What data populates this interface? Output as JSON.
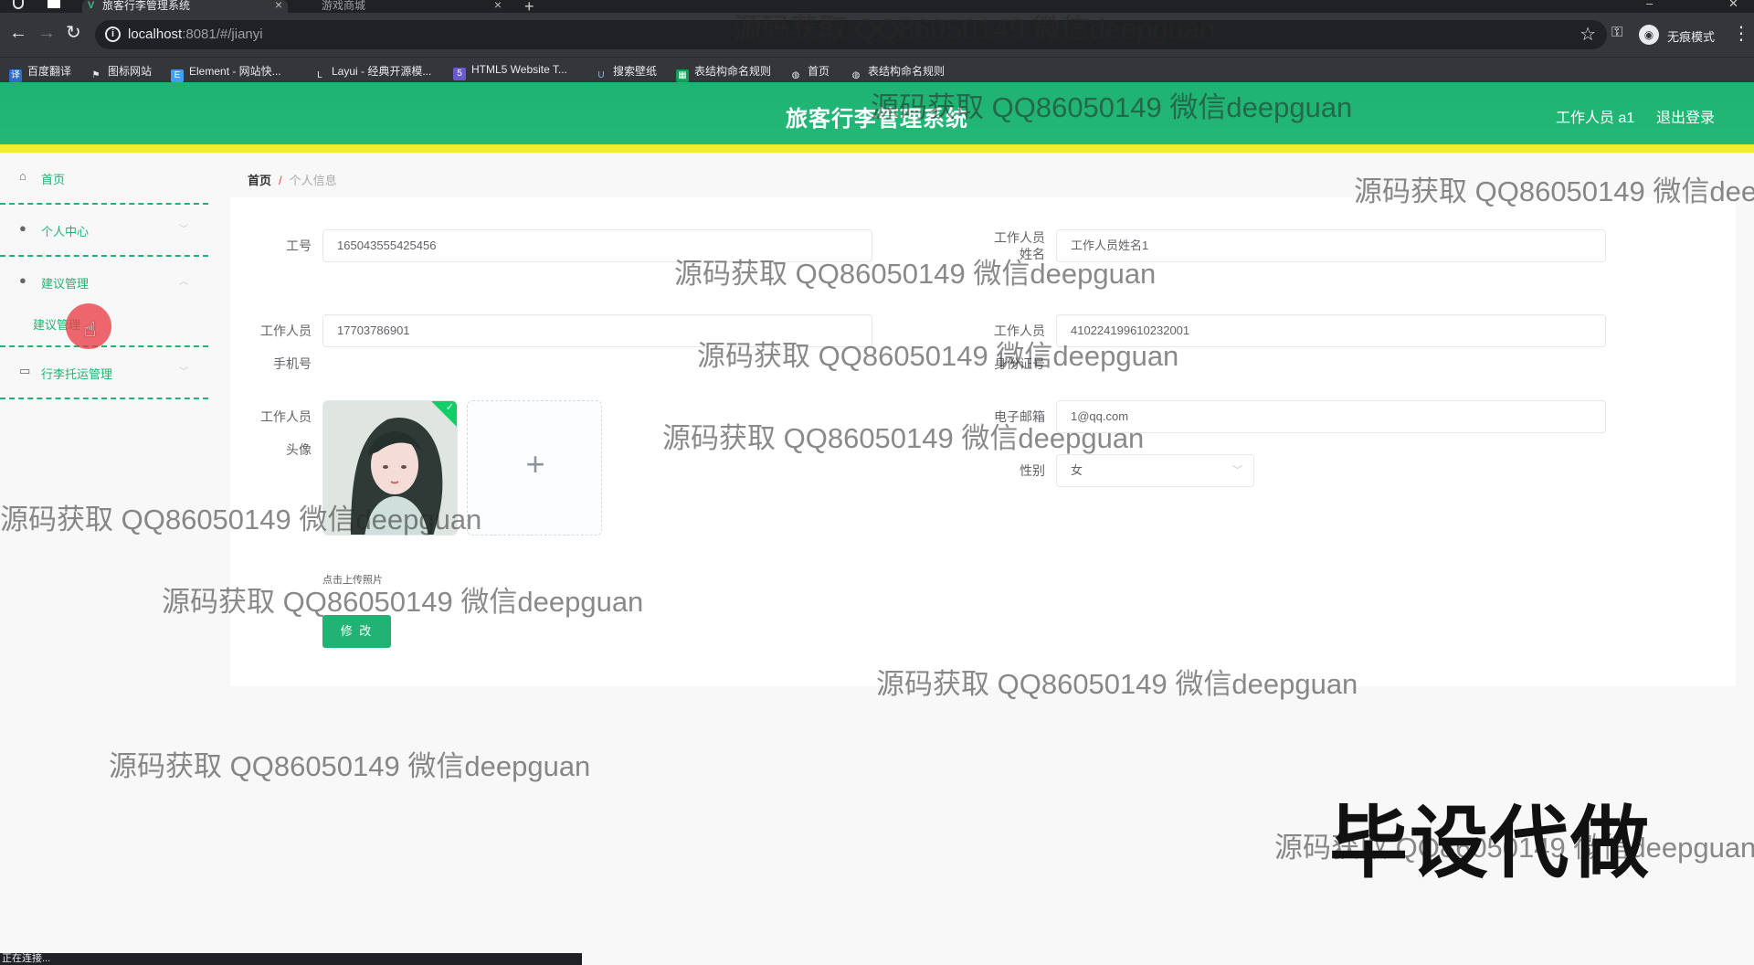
{
  "browser": {
    "tabs": [
      {
        "title": "旅客行李管理系统",
        "close": "×"
      },
      {
        "title": "游戏商城",
        "close": "×"
      }
    ],
    "new_tab": "+",
    "window_minimize": "–",
    "window_close": "✕",
    "url_host": "localhost",
    "url_path": ":8081/#/jianyi",
    "incognito_label": "无痕模式",
    "bookmarks": [
      "百度翻译",
      "图标网站",
      "Element - 网站快...",
      "Layui - 经典开源模...",
      "HTML5 Website T...",
      "搜索壁纸",
      "表结构命名规则",
      "首页",
      "表结构命名规则"
    ],
    "status_text": "正在连接..."
  },
  "header": {
    "title": "旅客行李管理系统",
    "user": "工作人员 a1",
    "logout": "退出登录"
  },
  "sidebar": {
    "items": [
      {
        "label": "首页",
        "icon": "home-icon"
      },
      {
        "label": "个人中心",
        "icon": "user-icon"
      },
      {
        "label": "建议管理",
        "icon": "user-icon"
      },
      {
        "label": "行李托运管理",
        "icon": "monitor-icon"
      }
    ],
    "submenu_item": "建议管理"
  },
  "breadcrumb": {
    "home": "首页",
    "sep": "/",
    "current": "个人信息"
  },
  "form": {
    "gonghao_label": "工号",
    "gonghao_value": "165043555425456",
    "name_label_1": "工作人员",
    "name_label_2": "姓名",
    "name_value": "工作人员姓名1",
    "phone_label_1": "工作人员",
    "phone_label_2": "手机号",
    "phone_value": "17703786901",
    "idcard_label_1": "工作人员",
    "idcard_label_2": "身份证号",
    "idcard_value": "410224199610232001",
    "avatar_label_1": "工作人员",
    "avatar_label_2": "头像",
    "email_label": "电子邮箱",
    "email_value": "1@qq.com",
    "gender_label": "性别",
    "gender_value": "女",
    "upload_tip": "点击上传照片",
    "submit": "修 改"
  },
  "watermark": "源码获取 QQ86050149 微信deepguan",
  "overlay_text": "毕设代做"
}
